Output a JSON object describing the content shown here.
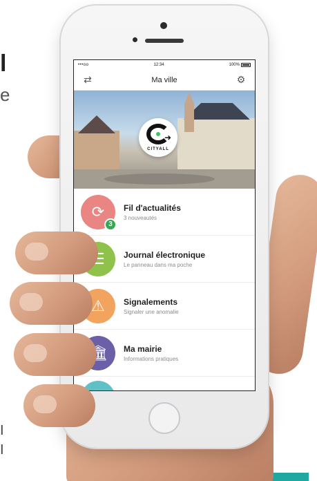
{
  "poster": {
    "edge_text_1": "l",
    "edge_text_2": "e",
    "edge_text_3": "I",
    "edge_text_4": "I"
  },
  "status_bar": {
    "signal": "•••oo",
    "time": "12:34",
    "battery": "100%"
  },
  "nav": {
    "title": "Ma ville",
    "left_icon": "⇄",
    "right_icon": "⚙"
  },
  "hero": {
    "logo_text": "CITYALL"
  },
  "menu": [
    {
      "title": "Fil d'actualités",
      "subtitle": "3 nouveautés",
      "badge": "3",
      "color": "#e98583",
      "icon": "refresh-icon",
      "glyph": "⟳"
    },
    {
      "title": "Journal électronique",
      "subtitle": "Le panneau dans ma poche",
      "color": "#8fc24a",
      "icon": "signboard-icon",
      "glyph": "☰"
    },
    {
      "title": "Signalements",
      "subtitle": "Signaler une anomalie",
      "color": "#f2a35e",
      "icon": "warning-icon",
      "glyph": "⚠"
    },
    {
      "title": "Ma mairie",
      "subtitle": "Informations pratiques",
      "color": "#6b5fa7",
      "icon": "townhall-icon",
      "glyph": "🏛"
    }
  ],
  "colors": {
    "accent_teal": "#1fa7a1",
    "badge_green": "#34a853"
  }
}
